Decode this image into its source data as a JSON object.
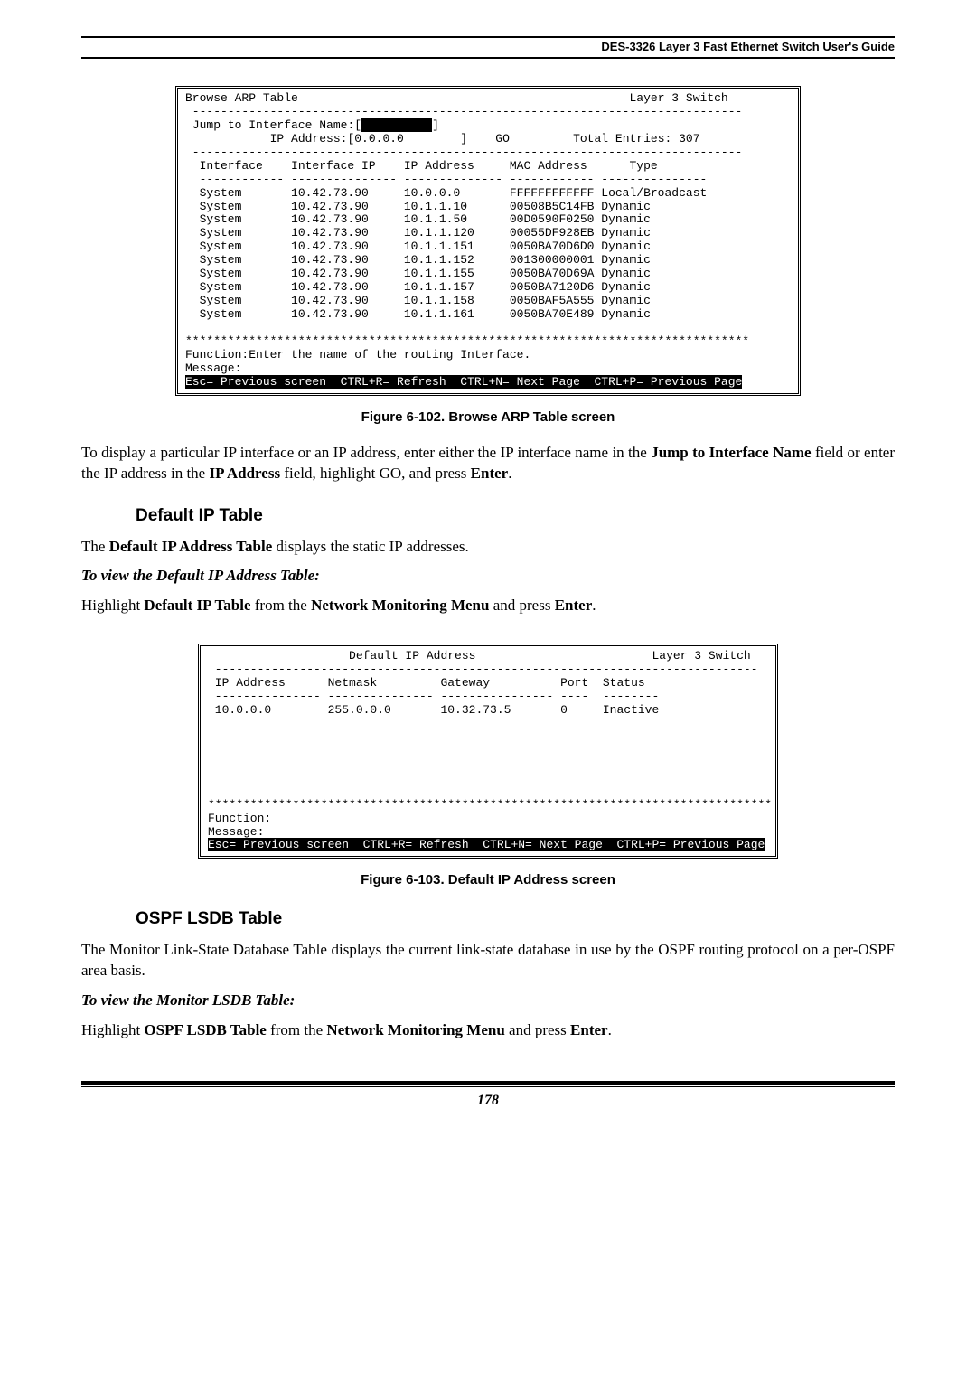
{
  "header": {
    "title": "DES-3326 Layer 3 Fast Ethernet Switch User's Guide"
  },
  "terminal1": {
    "title_left": "Browse ARP Table",
    "title_right": "Layer 3 Switch",
    "jump_label": "Jump to Interface Name:[",
    "jump_pad": "          ",
    "jump_bracket": "]",
    "ipaddr_label": "IP Address:[0.0.0.0        ]    GO         Total Entries: 307",
    "head": "  Interface    Interface IP    IP Address     MAC Address      Type",
    "dashes": "  ------------ --------------- -------------- ------------ ---------------",
    "rows": [
      "  System       10.42.73.90     10.0.0.0       FFFFFFFFFFFF Local/Broadcast",
      "  System       10.42.73.90     10.1.1.10      00508B5C14FB Dynamic",
      "  System       10.42.73.90     10.1.1.50      00D0590F0250 Dynamic",
      "  System       10.42.73.90     10.1.1.120     00055DF928EB Dynamic",
      "  System       10.42.73.90     10.1.1.151     0050BA70D6D0 Dynamic",
      "  System       10.42.73.90     10.1.1.152     001300000001 Dynamic",
      "  System       10.42.73.90     10.1.1.155     0050BA70D69A Dynamic",
      "  System       10.42.73.90     10.1.1.157     0050BA7120D6 Dynamic",
      "  System       10.42.73.90     10.1.1.158     0050BAF5A555 Dynamic",
      "  System       10.42.73.90     10.1.1.161     0050BA70E489 Dynamic"
    ],
    "stars": "********************************************************************************",
    "func": "Function:Enter the name of the routing Interface.",
    "msg": "Message:",
    "statusbar": "Esc= Previous screen  CTRL+R= Refresh  CTRL+N= Next Page  CTRL+P= Previous Page"
  },
  "fig1_caption": "Figure 6-102.  Browse ARP Table screen",
  "para1_a": "To display a particular IP interface or an IP address, enter either the IP interface name in the ",
  "para1_b": "Jump to Interface Name",
  "para1_c": " field or enter the IP address in the ",
  "para1_d": "IP Address",
  "para1_e": " field, highlight GO, and press ",
  "para1_f": "Enter",
  "section1": "Default IP Table",
  "para2_a": "The ",
  "para2_b": "Default IP Address Table",
  "para2_c": " displays the static IP addresses.",
  "para3": "To view the Default IP Address Table:",
  "para4_a": "Highlight ",
  "para4_b": "Default IP Table",
  "para4_c": " from the ",
  "para4_d": "Network Monitoring Menu",
  "para4_e": " and press ",
  "para4_f": "Enter",
  "terminal2": {
    "title_left": "                    Default IP Address                         Layer 3 Switch",
    "head": " IP Address      Netmask         Gateway          Port  Status",
    "dashes": " --------------- --------------- ---------------- ----  --------",
    "row": " 10.0.0.0        255.0.0.0       10.32.73.5       0     Inactive",
    "stars": "********************************************************************************",
    "func": "Function:",
    "msg": "Message:",
    "statusbar": "Esc= Previous screen  CTRL+R= Refresh  CTRL+N= Next Page  CTRL+P= Previous Page"
  },
  "fig2_caption": "Figure 6-103.  Default IP Address screen",
  "section2": "OSPF LSDB Table",
  "para5": "The Monitor Link-State Database Table displays the current link-state database in use by the OSPF routing protocol on a per-OSPF area basis.",
  "para6": "To view the Monitor LSDB Table:",
  "para7_a": "Highlight ",
  "para7_b": "OSPF LSDB Table",
  "para7_c": " from the ",
  "para7_d": "Network Monitoring Menu",
  "para7_e": " and press ",
  "para7_f": "Enter",
  "page_number": "178",
  "chart_data": [
    {
      "type": "table",
      "title": "Browse ARP Table",
      "columns": [
        "Interface",
        "Interface IP",
        "IP Address",
        "MAC Address",
        "Type"
      ],
      "rows": [
        [
          "System",
          "10.42.73.90",
          "10.0.0.0",
          "FFFFFFFFFFFF",
          "Local/Broadcast"
        ],
        [
          "System",
          "10.42.73.90",
          "10.1.1.10",
          "00508B5C14FB",
          "Dynamic"
        ],
        [
          "System",
          "10.42.73.90",
          "10.1.1.50",
          "00D0590F0250",
          "Dynamic"
        ],
        [
          "System",
          "10.42.73.90",
          "10.1.1.120",
          "00055DF928EB",
          "Dynamic"
        ],
        [
          "System",
          "10.42.73.90",
          "10.1.1.151",
          "0050BA70D6D0",
          "Dynamic"
        ],
        [
          "System",
          "10.42.73.90",
          "10.1.1.152",
          "001300000001",
          "Dynamic"
        ],
        [
          "System",
          "10.42.73.90",
          "10.1.1.155",
          "0050BA70D69A",
          "Dynamic"
        ],
        [
          "System",
          "10.42.73.90",
          "10.1.1.157",
          "0050BA7120D6",
          "Dynamic"
        ],
        [
          "System",
          "10.42.73.90",
          "10.1.1.158",
          "0050BAF5A555",
          "Dynamic"
        ],
        [
          "System",
          "10.42.73.90",
          "10.1.1.161",
          "0050BA70E489",
          "Dynamic"
        ]
      ],
      "meta": {
        "Total Entries": 307,
        "IP Address Field": "0.0.0.0"
      }
    },
    {
      "type": "table",
      "title": "Default IP Address",
      "columns": [
        "IP Address",
        "Netmask",
        "Gateway",
        "Port",
        "Status"
      ],
      "rows": [
        [
          "10.0.0.0",
          "255.0.0.0",
          "10.32.73.5",
          "0",
          "Inactive"
        ]
      ]
    }
  ]
}
